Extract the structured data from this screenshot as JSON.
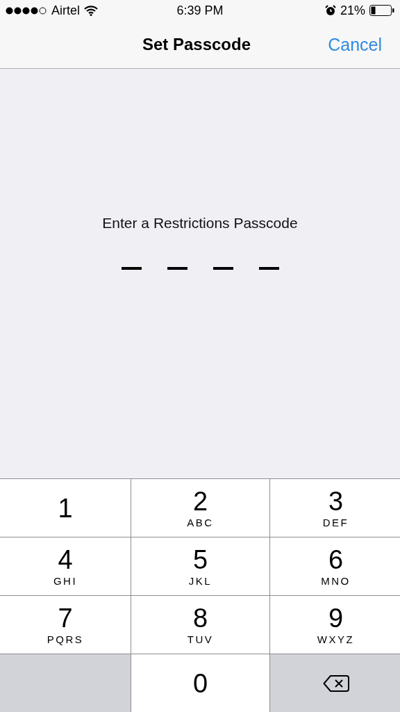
{
  "status_bar": {
    "carrier": "Airtel",
    "time": "6:39 PM",
    "battery": "21%"
  },
  "nav_bar": {
    "title": "Set Passcode",
    "action": "Cancel"
  },
  "prompt": "Enter a Restrictions Passcode",
  "passcode_slots": [
    {
      "filled": false
    },
    {
      "filled": false
    },
    {
      "filled": false
    },
    {
      "filled": false
    }
  ],
  "keypad": [
    {
      "kind": "digit",
      "digit": "1"
    },
    {
      "kind": "digit",
      "digit": "2",
      "letters": "ABC"
    },
    {
      "kind": "digit",
      "digit": "3",
      "letters": "DEF"
    },
    {
      "kind": "digit",
      "digit": "4",
      "letters": "GHI"
    },
    {
      "kind": "digit",
      "digit": "5",
      "letters": "JKL"
    },
    {
      "kind": "digit",
      "digit": "6",
      "letters": "MNO"
    },
    {
      "kind": "digit",
      "digit": "7",
      "letters": "PQRS"
    },
    {
      "kind": "digit",
      "digit": "8",
      "letters": "TUV"
    },
    {
      "kind": "digit",
      "digit": "9",
      "letters": "WXYZ"
    },
    {
      "kind": "blank"
    },
    {
      "kind": "digit",
      "digit": "0"
    },
    {
      "kind": "delete"
    }
  ]
}
